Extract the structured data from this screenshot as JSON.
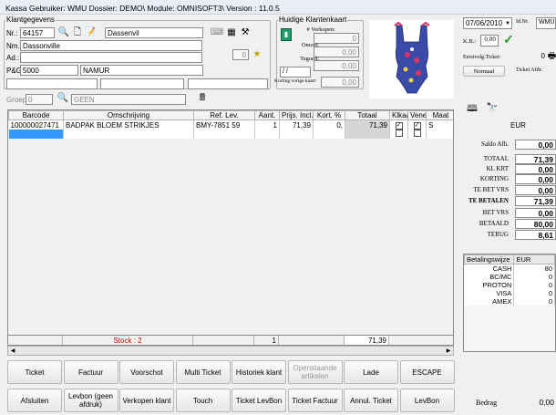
{
  "titlebar": "Kassa  Gebruiker: WMU  Dossier: DEMO\\  Module: OMNISOFT3\\   Version : 11.0.5",
  "klant": {
    "group_label": "Klantgegevens",
    "nr_label": "Nr.:",
    "nr_value": "64157",
    "shop_value": "Dassenvil",
    "nm_label": "Nm.:",
    "nm_value": "Dassonville",
    "ad_label": "Ad.:",
    "ad_value": "",
    "postcode_label": "P&G:",
    "postcode_value": "5000",
    "city_value": "NAMUR",
    "field_qty": "0",
    "groep_label": "Groep:",
    "groep_value": "0",
    "groep_name": "GEEN"
  },
  "klantenkaart": {
    "title": "Huidige Klantenkaart",
    "verkopen_label": "# Verkopen:",
    "verkopen_value": "0",
    "omzet_label": "Omzet:",
    "omzet_value": "0,00",
    "tegoed_label": "Tegoed:",
    "tegoed_value": "0,00",
    "date_value": "/ /",
    "korting_label": "Korting vorige kaart:",
    "korting_value": "0,00"
  },
  "right": {
    "date": "07/06/2010",
    "id_label": "Id.Nr.",
    "id_value": "WMU",
    "kb_label": "K.B.:",
    "kb_value": "0,00",
    "ticket_label": "Eerstvolg.Ticket:",
    "ticket_value": "0",
    "normaal_label": "Normaal",
    "ticket_afdr_label": "Ticket Afdr.",
    "currency": "EUR"
  },
  "grid": {
    "headers": [
      "Barcode",
      "Omschrijving",
      "Ref. Lev.",
      "Aant.",
      "Prijs. Incl.",
      "Kort. %",
      "Totaal",
      "Klkaa",
      "Vene",
      "Maat"
    ],
    "rows": [
      {
        "barcode": "100000027471",
        "omschrijving": "BADPAK BLOEM STRIKJES",
        "ref": "BMY-7851 59",
        "aant": "1",
        "prijs": "71,39",
        "kort": "0,",
        "totaal": "71,39",
        "klkaa": "✓",
        "vene": "✓",
        "maat": "S"
      }
    ],
    "stock": "Stock : 2",
    "sum_aant": "1",
    "sum_totaal": "71,39"
  },
  "totals": [
    {
      "label": "Saldo Afh.",
      "value": "0,00"
    },
    {
      "label": "TOTAAL",
      "value": "71,39"
    },
    {
      "label": "KL KRT",
      "value": "0,00"
    },
    {
      "label": "KORTING",
      "value": "0,00"
    },
    {
      "label": "TE BET VRS",
      "value": "0,00"
    },
    {
      "label": "TE BETALEN",
      "value": "71,39"
    },
    {
      "label": "BET VRS",
      "value": "0,00"
    },
    {
      "label": "BETAALD",
      "value": "80,00"
    },
    {
      "label": "TERUG",
      "value": "8,61"
    }
  ],
  "payment": {
    "header_method": "Betalingswijze",
    "header_cur": "EUR",
    "rows": [
      {
        "method": "CASH",
        "amount": "80"
      },
      {
        "method": "BC/MC",
        "amount": "0"
      },
      {
        "method": "PROTON",
        "amount": "0"
      },
      {
        "method": "VISA",
        "amount": "0"
      },
      {
        "method": "AMEX",
        "amount": "0"
      }
    ]
  },
  "bedrag_label": "Bedrag",
  "bedrag_value": "0,00",
  "buttons_row1": [
    "Ticket",
    "Factuur",
    "Voorschot",
    "Multi Ticket",
    "Historiek klant",
    "Openstaande artikelen",
    "Lade",
    "ESCAPE"
  ],
  "buttons_row2": [
    "Afsluiten",
    "Levbon (geen afdruk)",
    "Verkopen klant",
    "Touch",
    "Ticket LevBon",
    "Ticket Factuur",
    "Annul. Ticket",
    "LevBon"
  ],
  "colors": {
    "selection": "#3399ff",
    "check": "#2a9a2a",
    "gray_cell": "#d6d6d6"
  }
}
